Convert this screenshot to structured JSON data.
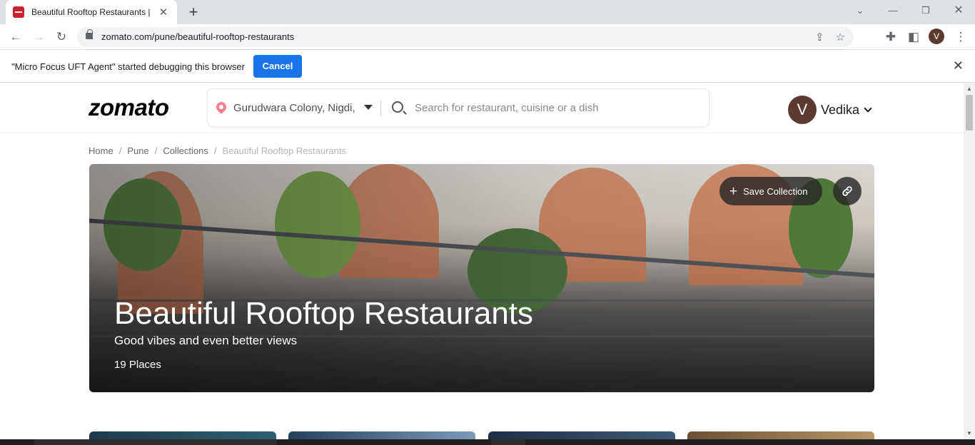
{
  "browser": {
    "tab_title": "Beautiful Rooftop Restaurants | Z",
    "url": "zomato.com/pune/beautiful-rooftop-restaurants",
    "profile_initial": "V"
  },
  "infobar": {
    "message": "\"Micro Focus UFT Agent\" started debugging this browser",
    "cancel_label": "Cancel"
  },
  "header": {
    "logo": "zomato",
    "location": "Gurudwara Colony, Nigdi,",
    "search_placeholder": "Search for restaurant, cuisine or a dish",
    "user_initial": "V",
    "user_name": "Vedika"
  },
  "breadcrumb": [
    "Home",
    "Pune",
    "Collections",
    "Beautiful Rooftop Restaurants"
  ],
  "hero": {
    "title": "Beautiful Rooftop Restaurants",
    "subtitle": "Good vibes and even better views",
    "places": "19 Places",
    "save_label": "Save Collection"
  },
  "colors": {
    "brand": "#cb202d",
    "cancel_button": "#1a73e8",
    "location_pin": "#ff7e8b"
  },
  "icons": [
    "back-arrow-icon",
    "forward-arrow-icon",
    "reload-icon",
    "lock-icon",
    "share-icon",
    "star-icon",
    "extensions-icon",
    "sidebar-icon",
    "close-icon",
    "location-pin-icon",
    "search-icon",
    "chevron-down-icon",
    "plus-icon",
    "link-icon"
  ]
}
